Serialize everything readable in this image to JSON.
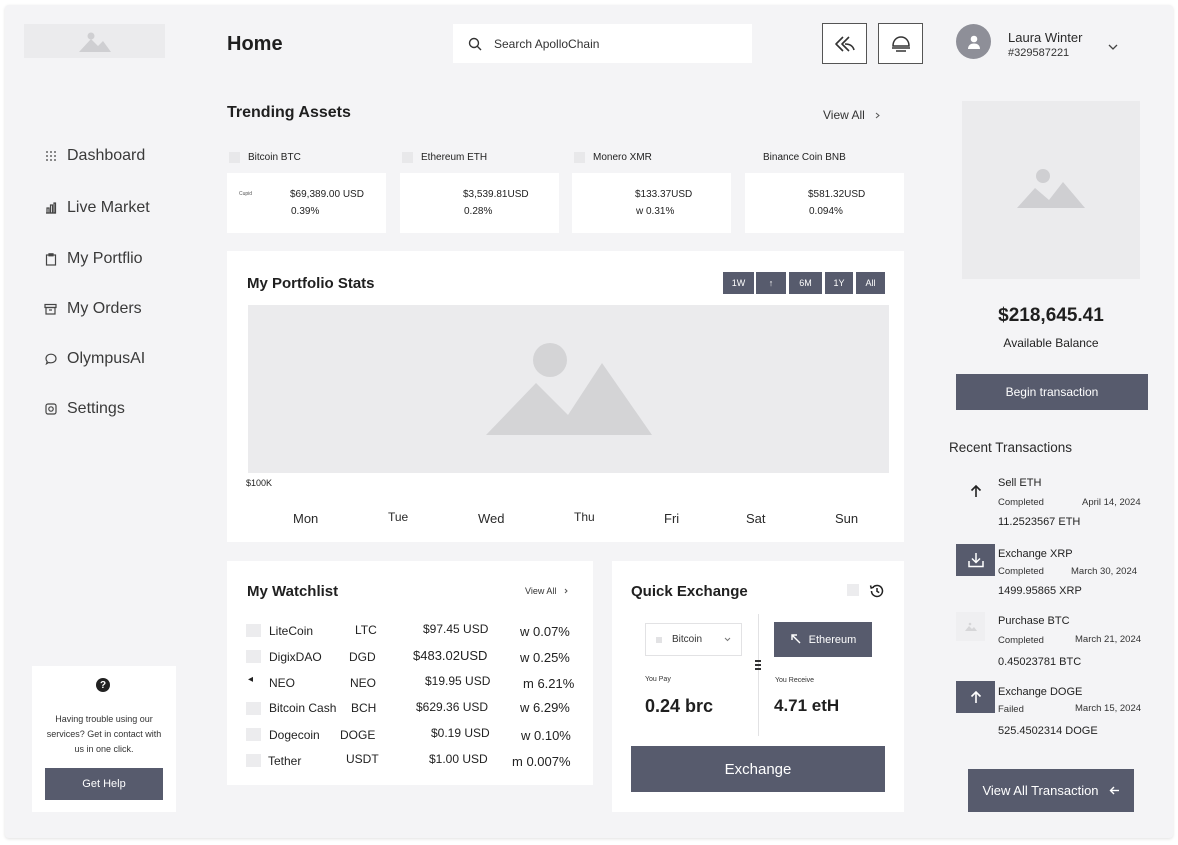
{
  "header": {
    "title": "Home",
    "search_placeholder": "Search ApolloChain",
    "user_name": "Laura Winter",
    "user_id": "#329587221"
  },
  "sidebar": {
    "items": [
      {
        "label": "Dashboard",
        "icon": "grid-dots-icon"
      },
      {
        "label": "Live Market",
        "icon": "bar-chart-icon"
      },
      {
        "label": "My Portflio",
        "icon": "clipboard-icon"
      },
      {
        "label": "My Orders",
        "icon": "box-icon"
      },
      {
        "label": "OlympusAI",
        "icon": "chat-bubble-icon"
      },
      {
        "label": "Settings",
        "icon": "settings-square-icon"
      }
    ],
    "help": {
      "text": "Having trouble using our services? Get in contact with us in one click.",
      "button": "Get Help"
    }
  },
  "trending": {
    "title": "Trending Assets",
    "view_all": "View All",
    "assets": [
      {
        "name": "Bitcoin BTC",
        "tag": "Cupid",
        "price": "$69,389.00 USD",
        "change": "0.39%"
      },
      {
        "name": "Ethereum ETH",
        "tag": "",
        "price": "$3,539.81USD",
        "change": "0.28%"
      },
      {
        "name": "Monero XMR",
        "tag": "",
        "price": "$133.37USD",
        "change": "w 0.31%"
      },
      {
        "name": "Binance Coin BNB",
        "tag": "",
        "price": "$581.32USD",
        "change": "0.094%"
      }
    ]
  },
  "portfolio_stats": {
    "title": "My Portfolio Stats",
    "ranges": [
      "1W",
      "↑",
      "6M",
      "1Y",
      "All"
    ],
    "y_label": "$100K",
    "days": [
      "Mon",
      "Tue",
      "Wed",
      "Thu",
      "Fri",
      "Sat",
      "Sun"
    ]
  },
  "watchlist": {
    "title": "My Watchlist",
    "view_all": "View All",
    "rows": [
      {
        "name": "LiteCoin",
        "symbol": "LTC",
        "price": "$97.45 USD",
        "change": "w 0.07%"
      },
      {
        "name": "DigixDAO",
        "symbol": "DGD",
        "price": "$483.02USD",
        "change": "w 0.25%"
      },
      {
        "name": "NEO",
        "symbol": "NEO",
        "price": "$19.95 USD",
        "change": "m 6.21%"
      },
      {
        "name": "Bitcoin Cash",
        "symbol": "BCH",
        "price": "$629.36 USD",
        "change": "w 6.29%"
      },
      {
        "name": "Dogecoin",
        "symbol": "DOGE",
        "price": "$0.19 USD",
        "change": "w 0.10%"
      },
      {
        "name": "Tether",
        "symbol": "USDT",
        "price": "$1.00 USD",
        "change": "m 0.007%"
      }
    ]
  },
  "quick_exchange": {
    "title": "Quick Exchange",
    "from_currency": "Bitcoin",
    "to_currency": "Ethereum",
    "pay_label": "You Pay",
    "pay_amount": "0.24 brc",
    "receive_label": "You Receive",
    "receive_amount": "4.71 etH",
    "button": "Exchange"
  },
  "balance": {
    "amount": "$218,645.41",
    "label": "Available Balance",
    "button": "Begin transaction"
  },
  "recent": {
    "title": "Recent Transactions",
    "items": [
      {
        "title": "Sell ETH",
        "status": "Completed",
        "date": "April 14, 2024",
        "amount": "11.2523567 ETH",
        "icon": "arrow-up-icon"
      },
      {
        "title": "Exchange XRP",
        "status": "Completed",
        "date": "March 30, 2024",
        "amount": "1499.95865 XRP",
        "icon": "download-icon"
      },
      {
        "title": "Purchase BTC",
        "status": "Completed",
        "date": "March 21, 2024",
        "amount": "0.45023781 BTC",
        "icon": "image-placeholder-icon"
      },
      {
        "title": "Exchange DOGE",
        "status": "Failed",
        "date": "March 15, 2024",
        "amount": "525.4502314 DOGE",
        "icon": "arrow-up-icon"
      }
    ],
    "view_all_button": "View All Transaction"
  }
}
